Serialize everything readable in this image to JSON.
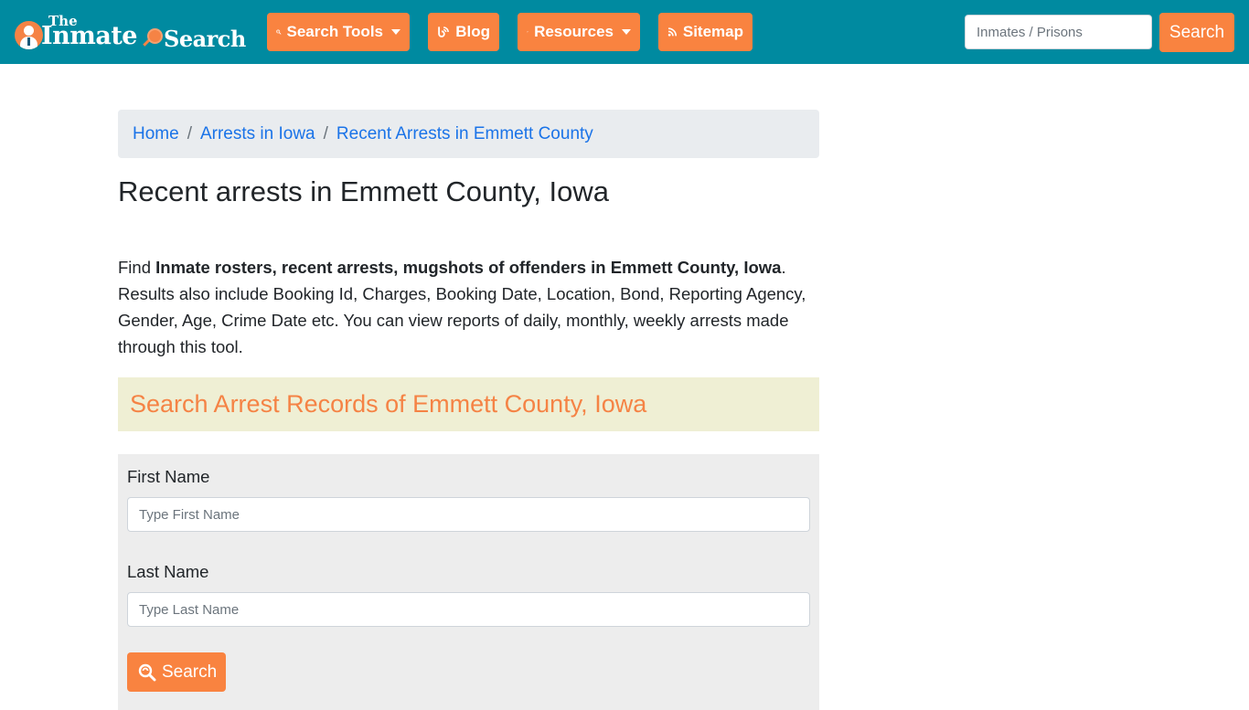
{
  "site": {
    "logo": {
      "line1": "The",
      "line2_a": "Inmate",
      "line2_b": "Search"
    },
    "colors": {
      "navbar_bg": "#008aa0",
      "accent_orange": "#f98340",
      "link_blue": "#1a73e8",
      "heading_box_bg": "#efefd4",
      "form_panel_bg": "#ededed"
    }
  },
  "nav": {
    "items": [
      {
        "label": "Search Tools",
        "icon": "search-tools-icon",
        "dropdown": true
      },
      {
        "label": "Blog",
        "icon": "blog-icon",
        "dropdown": false
      },
      {
        "label": "Resources",
        "icon": "leaf-icon",
        "dropdown": true
      },
      {
        "label": "Sitemap",
        "icon": "rss-icon",
        "dropdown": false
      }
    ],
    "search": {
      "placeholder": "Inmates / Prisons",
      "value": "",
      "button_label": "Search"
    }
  },
  "breadcrumb": [
    {
      "label": "Home"
    },
    {
      "label": "Arrests in Iowa"
    },
    {
      "label": "Recent Arrests in Emmett County"
    }
  ],
  "page": {
    "title": "Recent arrests in Emmett County, Iowa",
    "intro": {
      "prefix": "Find ",
      "bold": "Inmate rosters, recent arrests, mugshots of offenders in Emmett County, Iowa",
      "suffix": ". Results also include Booking Id, Charges, Booking Date, Location, Bond, Reporting Agency, Gender, Age, Crime Date etc. You can view reports of daily, monthly, weekly arrests made through this tool."
    },
    "search_heading": "Search Arrest Records of Emmett County, Iowa"
  },
  "form": {
    "first_name": {
      "label": "First Name",
      "placeholder": "Type First Name",
      "value": ""
    },
    "last_name": {
      "label": "Last Name",
      "placeholder": "Type Last Name",
      "value": ""
    },
    "submit_label": "Search"
  }
}
